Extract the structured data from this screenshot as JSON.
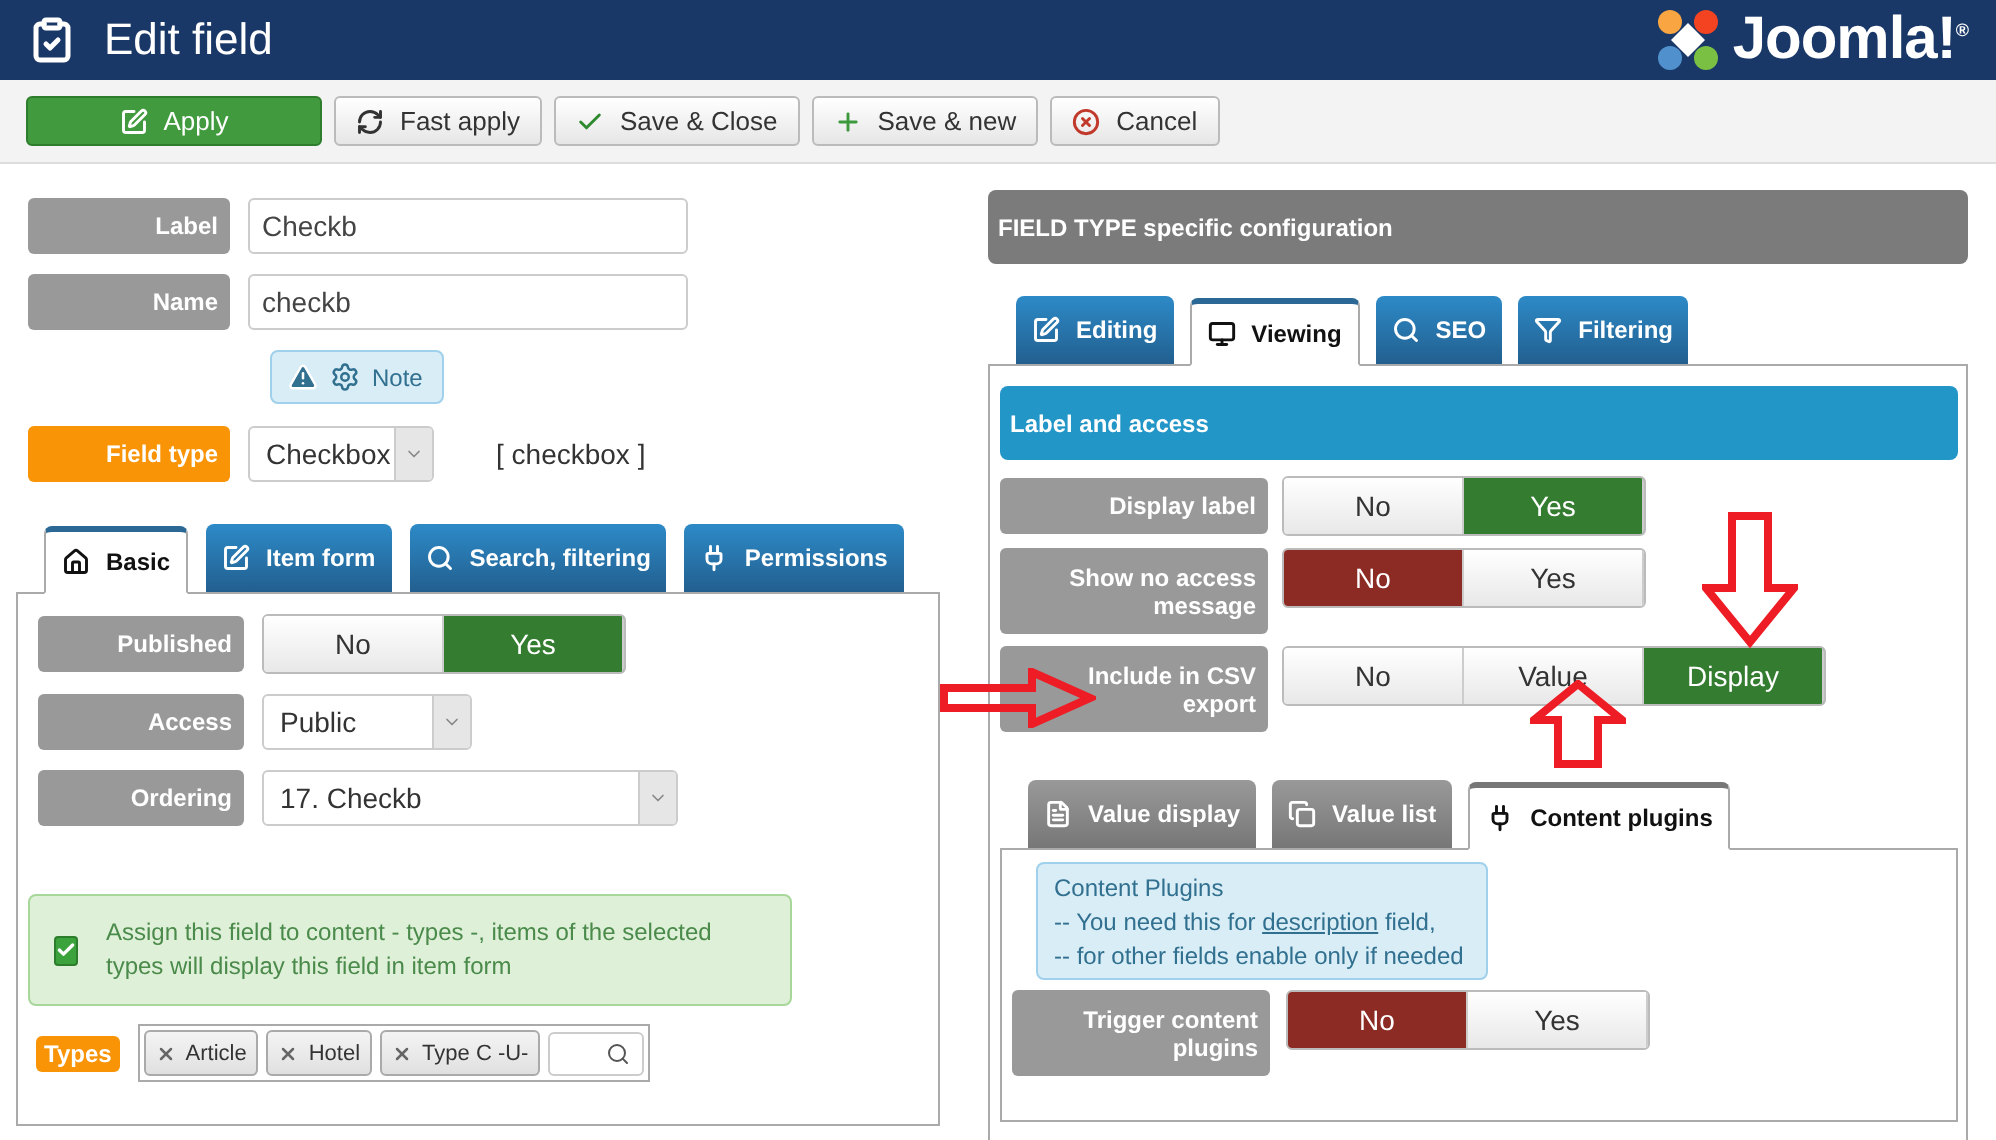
{
  "header": {
    "title": "Edit field",
    "logo_text": "Joomla!$^{®}$"
  },
  "toolbar": [
    {
      "label": "Apply",
      "kind": "primary"
    },
    {
      "label": "Fast apply",
      "kind": "default"
    },
    {
      "label": "Save & Close",
      "kind": "default"
    },
    {
      "label": "Save & new",
      "kind": "default"
    },
    {
      "label": "Cancel",
      "kind": "default"
    }
  ],
  "main_fields": [
    {
      "label": "Label",
      "value": "Checkb"
    },
    {
      "label": "Name",
      "value": "checkb"
    }
  ],
  "note": {
    "label": "Note"
  },
  "field_type": {
    "label": "Field type",
    "value": "Checkbox",
    "code": "[ checkbox ]"
  },
  "left_tabs": [
    {
      "label": "Basic",
      "selected": true
    },
    {
      "label": "Item form",
      "selected": false
    },
    {
      "label": "Search, filtering",
      "selected": false
    },
    {
      "label": "Permissions",
      "selected": false
    }
  ],
  "basic": {
    "published": {
      "label": "Published",
      "options": [
        {
          "label": "No",
          "selected": false
        },
        {
          "label": "Yes",
          "selected": true
        }
      ]
    },
    "access": {
      "label": "Access",
      "value": "Public"
    },
    "ordering": {
      "label": "Ordering",
      "value": "17. Checkb"
    },
    "assign_notice": {
      "text": "Assign this field to content - types -, items of the selected types will display this field in item form",
      "checked": true
    },
    "types": {
      "label": "Types",
      "tags": [
        "Article",
        "Hotel",
        "Type C -U-"
      ]
    }
  },
  "right": {
    "title": "FIELD TYPE specific configuration",
    "tabs": [
      {
        "label": "Editing",
        "selected": false
      },
      {
        "label": "Viewing",
        "selected": true
      },
      {
        "label": "SEO",
        "selected": false
      },
      {
        "label": "Filtering",
        "selected": false
      }
    ],
    "section_title": "Label and access",
    "settings": [
      {
        "label": "Display label",
        "options": [
          {
            "label": "No",
            "selected": false
          },
          {
            "label": "Yes",
            "selected": true
          }
        ]
      },
      {
        "label": "Show no access message",
        "options": [
          {
            "label": "No",
            "selected": true
          },
          {
            "label": "Yes",
            "selected": false
          }
        ]
      },
      {
        "label": "Include in CSV export",
        "options": [
          {
            "label": "No",
            "selected": false
          },
          {
            "label": "Value",
            "selected": false
          },
          {
            "label": "Display",
            "selected": true
          }
        ]
      }
    ],
    "sub_tabs": [
      {
        "label": "Value display",
        "selected": false
      },
      {
        "label": "Value list",
        "selected": false
      },
      {
        "label": "Content plugins",
        "selected": true
      }
    ],
    "info": {
      "title": "Content Plugins",
      "line_1_before": "-- You need this for",
      "line_1_link": "description",
      "line_1_after": "field,",
      "line_2": "-- for other fields enable only if needed"
    },
    "trigger": {
      "label": "Trigger content plugins",
      "options": [
        {
          "label": "No",
          "selected": true
        },
        {
          "label": "Yes",
          "selected": false
        }
      ]
    }
  }
}
